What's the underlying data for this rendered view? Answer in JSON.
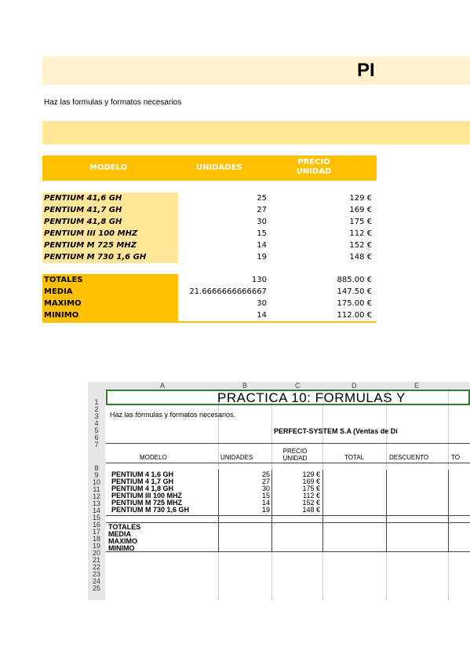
{
  "title": "PI",
  "instructions": "Haz las formulas y formatos necesarios",
  "table": {
    "headers": {
      "model": "MODELO",
      "units": "UNIDADES",
      "price": "PRECIO UNIDAD"
    },
    "rows": [
      {
        "model": "PENTIUM 41,6 GH",
        "units": "25",
        "price": "129 €"
      },
      {
        "model": "PENTIUM 41,7 GH",
        "units": "27",
        "price": "169 €"
      },
      {
        "model": "PENTIUM 41,8 GH",
        "units": "30",
        "price": "175 €"
      },
      {
        "model": "PENTIUM III 100 MHZ",
        "units": "15",
        "price": "112 €"
      },
      {
        "model": "PENTIUM M 725 MHZ",
        "units": "14",
        "price": "152 €"
      },
      {
        "model": "PENTIUM M 730 1,6 GH",
        "units": "19",
        "price": "148 €"
      }
    ],
    "summary": [
      {
        "label": "TOTALES",
        "units": "130",
        "price": "885.00 €"
      },
      {
        "label": "MEDIA",
        "units": "21.6666666666667",
        "price": "147.50 €"
      },
      {
        "label": "MAXIMO",
        "units": "30",
        "price": "175.00 €"
      },
      {
        "label": "MINIMO",
        "units": "14",
        "price": "112.00 €"
      }
    ]
  },
  "screenshot": {
    "columns": [
      "A",
      "B",
      "C",
      "D",
      "E"
    ],
    "row_numbers": [
      "1",
      "2",
      "3",
      "4",
      "5",
      "6",
      "7",
      "8",
      "9",
      "10",
      "11",
      "12",
      "13",
      "14",
      "15",
      "16",
      "17",
      "18",
      "19",
      "20",
      "21",
      "22",
      "23",
      "24",
      "25"
    ],
    "title": "PRACTICA 10: FORMULAS Y",
    "instructions": "Haz las fórmulas y formatos necesarios.",
    "company": "PERFECT-SYSTEM S.A (Ventas de Di",
    "headers": [
      "MODELO",
      "UNIDADES",
      "PRECIO UNIDAD",
      "TOTAL",
      "DESCUENTO",
      "TO"
    ],
    "rows": [
      {
        "model": "PENTIUM 4 1,6 GH",
        "units": "25",
        "price": "129 €"
      },
      {
        "model": "PENTIUM 4 1,7 GH",
        "units": "27",
        "price": "169 €"
      },
      {
        "model": "PENTIUM 4 1,8 GH",
        "units": "30",
        "price": "175 €"
      },
      {
        "model": "PENTIUM III 100 MHZ",
        "units": "15",
        "price": "112 €"
      },
      {
        "model": "PENTIUM M 725 MHZ",
        "units": "14",
        "price": "152 €"
      },
      {
        "model": "PENTIUM M 730 1,6 GH",
        "units": "19",
        "price": "148 €"
      }
    ],
    "summary_labels": [
      "TOTALES",
      "MEDIA",
      "MAXIMO",
      "MINIMO"
    ]
  }
}
